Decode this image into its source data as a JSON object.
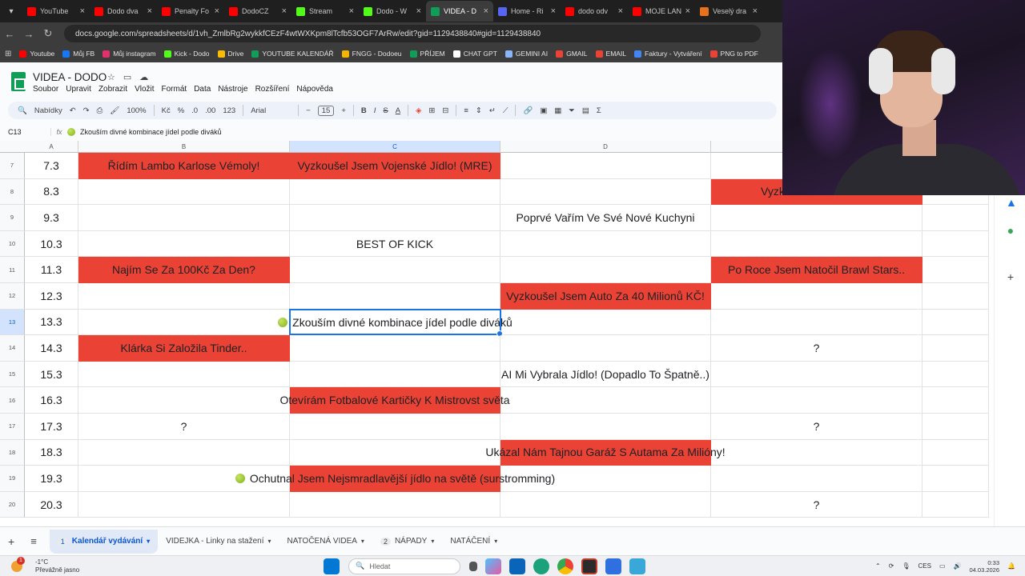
{
  "browser": {
    "tabs": [
      {
        "label": "YouTube",
        "color": "#ff0000"
      },
      {
        "label": "Dodo dva",
        "color": "#ff0000"
      },
      {
        "label": "Penalty Fo",
        "color": "#ff0000"
      },
      {
        "label": "DodoCZ",
        "color": "#ff0000"
      },
      {
        "label": "Stream",
        "color": "#53fc18"
      },
      {
        "label": "Dodo - W",
        "color": "#53fc18"
      },
      {
        "label": "VIDEA - D",
        "color": "#0f9d58",
        "active": true
      },
      {
        "label": "Home - Ri",
        "color": "#5865f2"
      },
      {
        "label": "dodo odv",
        "color": "#ff0000"
      },
      {
        "label": "MOJE LAN",
        "color": "#ff0000"
      },
      {
        "label": "Veselý dra",
        "color": "#e8711c"
      }
    ],
    "url": "docs.google.com/spreadsheets/d/1vh_ZmlbRg2wykkfCEzF4wtWXKpm8lTcfb53OGF7ArRw/edit?gid=1129438840#gid=1129438840",
    "bookmarks": [
      {
        "label": "Youtube",
        "color": "#ff0000"
      },
      {
        "label": "Můj FB",
        "color": "#1877f2"
      },
      {
        "label": "Můj instagram",
        "color": "#e1306c"
      },
      {
        "label": "Kick - Dodo",
        "color": "#53fc18"
      },
      {
        "label": "Drive",
        "color": "#fbbc04"
      },
      {
        "label": "YOUTUBE KALENDÁŘ",
        "color": "#0f9d58"
      },
      {
        "label": "FNGG - Dodoeu",
        "color": "#f4b400"
      },
      {
        "label": "PŘÍJEM",
        "color": "#0f9d58"
      },
      {
        "label": "CHAT GPT",
        "color": "#ffffff"
      },
      {
        "label": "GEMINI AI",
        "color": "#8ab4f8"
      },
      {
        "label": "GMAIL",
        "color": "#ea4335"
      },
      {
        "label": "EMAIL",
        "color": "#ea4335"
      },
      {
        "label": "Faktury - Vytváření",
        "color": "#4285f4"
      },
      {
        "label": "PNG to PDF",
        "color": "#ea4335"
      }
    ]
  },
  "doc": {
    "title": "VIDEA - DODO",
    "menus": [
      "Soubor",
      "Upravit",
      "Zobrazit",
      "Vložit",
      "Formát",
      "Data",
      "Nástroje",
      "Rozšíření",
      "Nápověda"
    ],
    "toolbar": {
      "search": "Nabídky",
      "zoom": "100%",
      "currency": "Kč",
      "percent": "%",
      "decimal_dec": ".0",
      "decimal_inc": ".00",
      "number_format": "123",
      "font": "Arial",
      "font_size": "15"
    },
    "name_box": "C13",
    "formula": "Zkouším divné kombinace jídel podle diváků"
  },
  "sheet": {
    "columns": [
      "A",
      "B",
      "C",
      "D"
    ],
    "selected_column": "C",
    "selected_row": "13",
    "rows": [
      {
        "num": "7",
        "a": "7.3",
        "b": "Řídím Lambo Karlose Vémoly!",
        "b_red": true,
        "c": "Vyzkoušel Jsem Vojenské Jídlo! (MRE)",
        "c_red": true,
        "d": "",
        "e": ""
      },
      {
        "num": "8",
        "a": "8.3",
        "b": "",
        "c": "",
        "d": "",
        "e": "Vyzkouše",
        "e_red": true
      },
      {
        "num": "9",
        "a": "9.3",
        "b": "",
        "c": "",
        "d": "Poprvé Vařím Ve Své Nové Kuchyni",
        "e": ""
      },
      {
        "num": "10",
        "a": "10.3",
        "b": "",
        "c": "BEST OF KICK",
        "d": "",
        "e": ""
      },
      {
        "num": "11",
        "a": "11.3",
        "b": "Najím Se Za 100Kč Za Den?",
        "b_red": true,
        "c": "",
        "d": "",
        "e": "Po Roce Jsem Natočil Brawl Stars..",
        "e_red": true
      },
      {
        "num": "12",
        "a": "12.3",
        "b": "",
        "c": "",
        "d": "Vyzkoušel Jsem Auto Za 40 Milionů KČ!",
        "d_red": true,
        "e": ""
      },
      {
        "num": "13",
        "a": "13.3",
        "b": "",
        "c": "Zkouším divné kombinace jídel podle diváků",
        "c_overflow": true,
        "d": "",
        "e": ""
      },
      {
        "num": "14",
        "a": "14.3",
        "b": "Klárka Si Založila Tinder..",
        "b_red": true,
        "c": "",
        "d": "",
        "e": "?"
      },
      {
        "num": "15",
        "a": "15.3",
        "b": "",
        "c": "",
        "d": "AI Mi Vybrala Jídlo! (Dopadlo To Špatně..)",
        "e": ""
      },
      {
        "num": "16",
        "a": "16.3",
        "b": "",
        "c": "Otevírám Fotbalové Kartičky K Mistrovst světa",
        "c_red": true,
        "d": "",
        "e": ""
      },
      {
        "num": "17",
        "a": "17.3",
        "b": "?",
        "c": "",
        "d": "",
        "e": "?"
      },
      {
        "num": "18",
        "a": "18.3",
        "b": "",
        "c": "",
        "d": "Ukázal Nám Tajnou Garáž S Autama Za Milióny!",
        "d_red": true,
        "e": ""
      },
      {
        "num": "19",
        "a": "19.3",
        "b": "",
        "c": "Ochutnal Jsem Nejsmradlavější jídlo na světě (surstromming)",
        "c_red": true,
        "c_overflow": true,
        "d": "",
        "e": ""
      },
      {
        "num": "20",
        "a": "20.3",
        "b": "",
        "c": "",
        "d": "",
        "e": "?"
      }
    ]
  },
  "sheet_tabs": [
    {
      "num": "1",
      "label": "Kalendář vydávání",
      "active": true
    },
    {
      "num": "",
      "label": "VIDEJKA - Linky na stažení"
    },
    {
      "num": "",
      "label": "NATOČENÁ VIDEA"
    },
    {
      "num": "2",
      "label": "NÁPADY"
    },
    {
      "num": "",
      "label": "NATÁČENÍ"
    }
  ],
  "taskbar": {
    "badge": "1",
    "weather_temp": "-1°C",
    "weather_desc": "Převážně jasno",
    "search": "Hledat",
    "lang": "CES",
    "time": "0:33",
    "date": "04.03.2026"
  },
  "colors": {
    "red_cell": "#ea4335",
    "selection": "#1a73e8"
  }
}
